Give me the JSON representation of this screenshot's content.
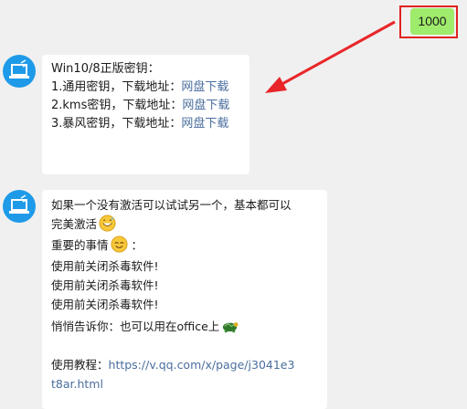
{
  "sent": {
    "text": "1000"
  },
  "colors": {
    "sent_bubble": "#9feb6b",
    "highlight_box": "#e0231f",
    "arrow": "#e8262a",
    "link": "#4a6e9e",
    "avatar": "#1e9ae8"
  },
  "message1": {
    "title": "Win10/8正版密钥：",
    "items": [
      {
        "text": "1.通用密钥，下载地址：",
        "link": "网盘下载"
      },
      {
        "text": "2.kms密钥，下载地址：",
        "link": "网盘下载"
      },
      {
        "text": "3.暴风密钥，下载地址：",
        "link": "网盘下载"
      }
    ]
  },
  "message2": {
    "intro_line1": "如果一个没有激活可以试试另一个，基本都可以",
    "intro_line2": "完美激活",
    "important_label": "重要的事情",
    "important_colon": "：",
    "warnings": [
      "使用前关闭杀毒软件!",
      "使用前关闭杀毒软件!",
      "使用前关闭杀毒软件!"
    ],
    "tip": "悄悄告诉你：也可以用在office上",
    "tutorial_label": "使用教程：",
    "tutorial_url_line1": "https://v.qq.com/x/page/j3041e3",
    "tutorial_url_line2": "t8ar.html"
  },
  "icons": {
    "avatar": "laptop-icon",
    "emoji_grin": "grinning-sweat-emoji-icon",
    "emoji_wink": "smiling-emoji-icon",
    "emoji_turtle": "turtle-emoji-icon"
  }
}
